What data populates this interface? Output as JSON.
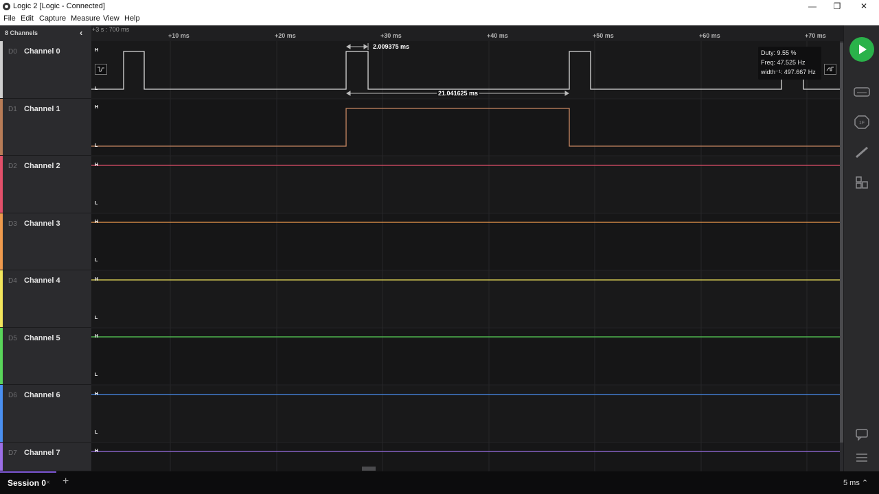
{
  "window": {
    "title": "Logic 2 [Logic - Connected]",
    "minimize": "—",
    "maximize": "❐",
    "close": "✕"
  },
  "menu": [
    "File",
    "Edit",
    "Capture",
    "Measure",
    "View",
    "Help"
  ],
  "sidebar": {
    "header": "8 Channels",
    "collapse_glyph": "‹"
  },
  "channels": [
    {
      "index": "D0",
      "name": "Channel 0",
      "color": "#cfcfcf"
    },
    {
      "index": "D1",
      "name": "Channel 1",
      "color": "#b87c57"
    },
    {
      "index": "D2",
      "name": "Channel 2",
      "color": "#e2506a"
    },
    {
      "index": "D3",
      "name": "Channel 3",
      "color": "#ee9a4d"
    },
    {
      "index": "D4",
      "name": "Channel 4",
      "color": "#f2e55c"
    },
    {
      "index": "D5",
      "name": "Channel 5",
      "color": "#59d55a"
    },
    {
      "index": "D6",
      "name": "Channel 6",
      "color": "#4a8ff0"
    },
    {
      "index": "D7",
      "name": "Channel 7",
      "color": "#9c6fe6"
    }
  ],
  "level_labels": {
    "high": "H",
    "low": "L"
  },
  "timeline": {
    "origin": "+3 s : 700 ms",
    "ticks": [
      "+10 ms",
      "+20 ms",
      "+30 ms",
      "+40 ms",
      "+50 ms",
      "+60 ms",
      "+70 ms"
    ]
  },
  "measurements": {
    "pulse_width": "2.009375 ms",
    "period": "21.041625 ms"
  },
  "tooltip": {
    "duty": "Duty: 9.55 %",
    "freq": "Freq: 47.525 Hz",
    "width_inv": "width⁻¹: 497.667 Hz"
  },
  "bottom": {
    "session_label": "Session 0",
    "session_close": "×",
    "add_tab": "+",
    "zoom_label": "5 ms ⌃"
  },
  "right_panel_icons": [
    "play-icon",
    "analyzers-icon",
    "extensions-icon",
    "measure-icon",
    "layout-icon",
    "feedback-icon",
    "menu-icon"
  ]
}
